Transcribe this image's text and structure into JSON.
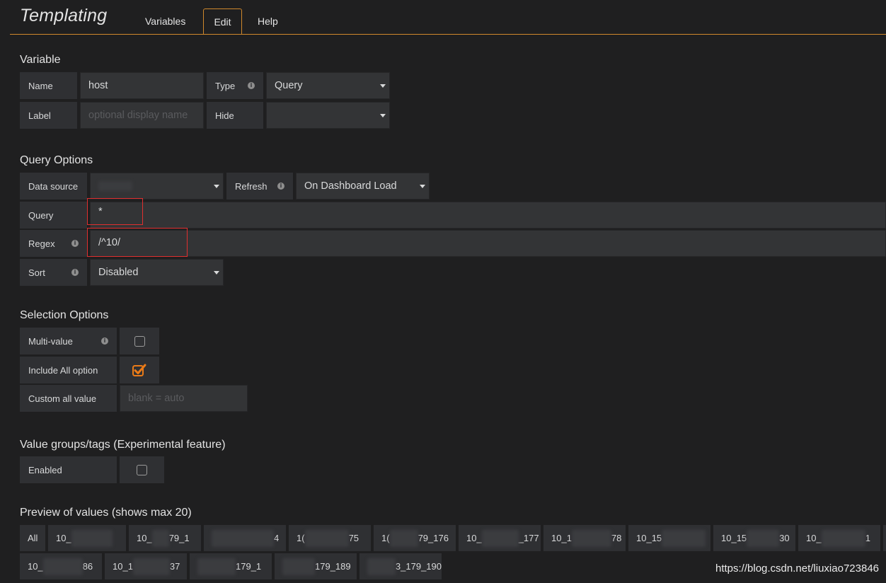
{
  "header": {
    "title": "Templating",
    "tabs": [
      {
        "label": "Variables",
        "active": false
      },
      {
        "label": "Edit",
        "active": true
      },
      {
        "label": "Help",
        "active": false
      }
    ]
  },
  "variable": {
    "section_title": "Variable",
    "name_label": "Name",
    "name_value": "host",
    "type_label": "Type",
    "type_value": "Query",
    "label_label": "Label",
    "label_placeholder": "optional display name",
    "hide_label": "Hide",
    "hide_value": ""
  },
  "query_options": {
    "section_title": "Query Options",
    "datasource_label": "Data source",
    "datasource_value": "",
    "refresh_label": "Refresh",
    "refresh_value": "On Dashboard Load",
    "query_label": "Query",
    "query_value": "*",
    "regex_label": "Regex",
    "regex_value": "/^10/",
    "sort_label": "Sort",
    "sort_value": "Disabled"
  },
  "selection_options": {
    "section_title": "Selection Options",
    "multi_label": "Multi-value",
    "multi_checked": false,
    "include_all_label": "Include All option",
    "include_all_checked": true,
    "custom_all_label": "Custom all value",
    "custom_all_placeholder": "blank = auto"
  },
  "value_groups": {
    "section_title": "Value groups/tags (Experimental feature)",
    "enabled_label": "Enabled",
    "enabled_checked": false
  },
  "preview": {
    "section_title": "Preview of values (shows max 20)",
    "row1": [
      {
        "pre": "All",
        "post": ""
      },
      {
        "pre": "10_",
        "post": ""
      },
      {
        "pre": "10_",
        "post": "79_1"
      },
      {
        "pre": "",
        "post": "4"
      },
      {
        "pre": "1(",
        "post": "75"
      },
      {
        "pre": "1(",
        "post": "79_176"
      },
      {
        "pre": "10_",
        "post": "_177"
      },
      {
        "pre": "10_1",
        "post": "78"
      },
      {
        "pre": "10_15",
        "post": ""
      },
      {
        "pre": "10_15",
        "post": "30"
      },
      {
        "pre": "10_",
        "post": "1"
      }
    ],
    "row2": [
      {
        "pre": "10_",
        "post": "86"
      },
      {
        "pre": "10_1",
        "post": "37"
      },
      {
        "pre": "",
        "post": "179_1"
      },
      {
        "pre": "",
        "post": "179_189"
      },
      {
        "pre": "",
        "post": "3_179_190"
      }
    ]
  },
  "watermark": "https://blog.csdn.net/liuxiao723846",
  "colors": {
    "accent": "#d0882c",
    "highlight": "#e02f2f",
    "check": "#eb7b18"
  }
}
